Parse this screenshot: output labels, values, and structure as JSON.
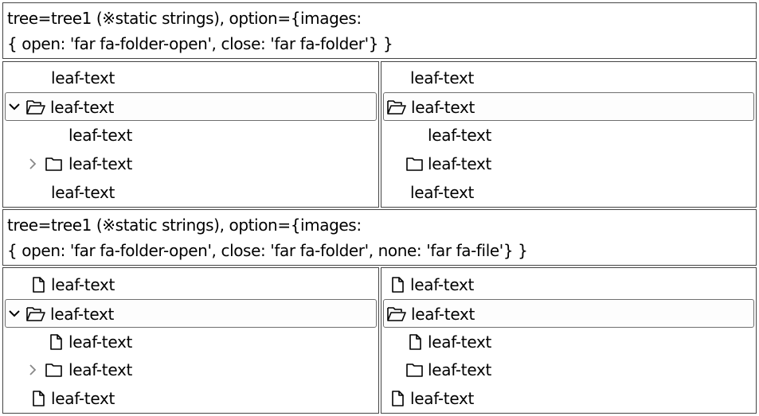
{
  "section1": {
    "caption_line1": "tree=tree1 (※static strings), option={images:",
    "caption_line2": "{ open: 'far fa-folder-open', close: 'far fa-folder'} }"
  },
  "section2": {
    "caption_line1": "tree=tree1 (※static strings), option={images:",
    "caption_line2": "{ open: 'far fa-folder-open', close: 'far fa-folder', none: 'far fa-file'} }"
  },
  "tree": {
    "items": [
      {
        "label": "leaf-text"
      },
      {
        "label": "leaf-text"
      },
      {
        "label": "leaf-text"
      },
      {
        "label": "leaf-text"
      },
      {
        "label": "leaf-text"
      }
    ]
  },
  "icons": {
    "open": "folder-open-icon",
    "close": "folder-icon",
    "none": "file-icon",
    "expanded": "chevron-down-icon",
    "collapsed": "chevron-right-icon"
  },
  "colors": {
    "border": "#444444",
    "selected_border": "#6f6f6f",
    "chevron_collapsed": "#888888"
  }
}
